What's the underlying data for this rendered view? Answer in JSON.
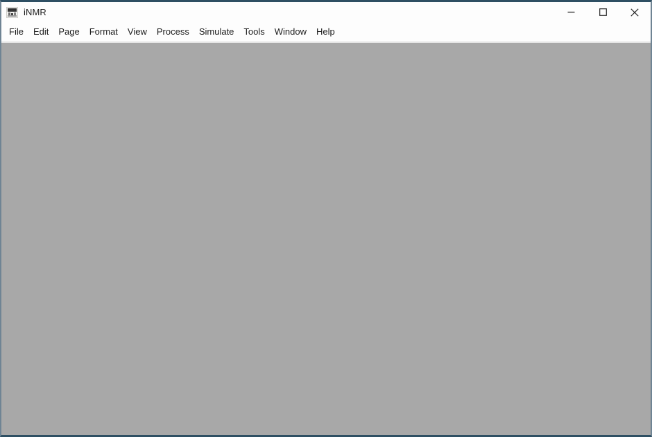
{
  "window": {
    "title": "iNMR",
    "app_icon": "inmr-app-icon",
    "frame_color": "#2e4f63",
    "frame_side_color": "#6f8494",
    "titlebar_background": "#fdfdfd",
    "client_background": "#a8a8a8"
  },
  "window_controls": [
    {
      "name": "minimize",
      "icon": "minimize-icon",
      "glyph": "—"
    },
    {
      "name": "maximize",
      "icon": "maximize-icon",
      "glyph": "□"
    },
    {
      "name": "close",
      "icon": "close-icon",
      "glyph": "✕"
    }
  ],
  "menubar": {
    "items": [
      {
        "label": "File"
      },
      {
        "label": "Edit"
      },
      {
        "label": "Page"
      },
      {
        "label": "Format"
      },
      {
        "label": "View"
      },
      {
        "label": "Process"
      },
      {
        "label": "Simulate"
      },
      {
        "label": "Tools"
      },
      {
        "label": "Window"
      },
      {
        "label": "Help"
      }
    ]
  },
  "client": {
    "content": "",
    "state": "empty-workspace"
  }
}
